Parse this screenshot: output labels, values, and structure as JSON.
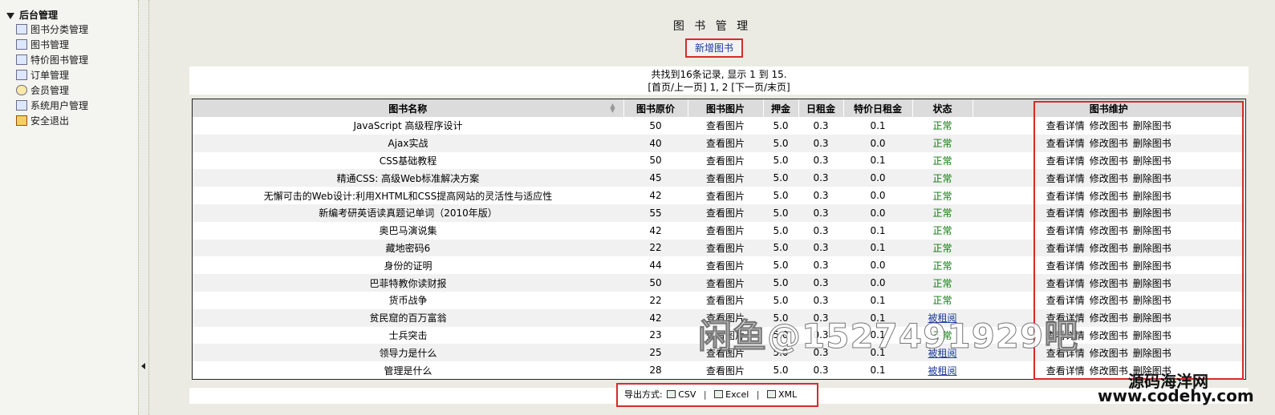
{
  "sidebar": {
    "section_title": "后台管理",
    "items": [
      {
        "label": "图书分类管理",
        "icon": "category-icon"
      },
      {
        "label": "图书管理",
        "icon": "book-icon"
      },
      {
        "label": "特价图书管理",
        "icon": "special-book-icon"
      },
      {
        "label": "订单管理",
        "icon": "order-icon"
      },
      {
        "label": "会员管理",
        "icon": "members-icon"
      },
      {
        "label": "系统用户管理",
        "icon": "user-icon"
      },
      {
        "label": "安全退出",
        "icon": "exit-icon"
      }
    ]
  },
  "main": {
    "title": "图 书 管 理",
    "add_button": "新增图书",
    "pager": {
      "summary": "共找到16条记录, 显示 1 到 15.",
      "nav_open": "[",
      "first_prev": "首页/上一页",
      "nav_close_pages": "] 1, 2 [",
      "next_last": "下一页/末页",
      "nav_end": "]"
    },
    "columns": [
      "图书名称",
      "图书原价",
      "图书图片",
      "押金",
      "日租金",
      "特价日租金",
      "状态",
      "图书维护"
    ],
    "actions": {
      "view": "查看详情",
      "edit": "修改图书",
      "delete": "删除图书"
    },
    "rows": [
      {
        "name": "JavaScript 高级程序设计",
        "price": "50",
        "image": "查看图片",
        "deposit": "5.0",
        "rent": "0.3",
        "special": "0.1",
        "status": "正常",
        "status_type": "normal"
      },
      {
        "name": "Ajax实战",
        "price": "40",
        "image": "查看图片",
        "deposit": "5.0",
        "rent": "0.3",
        "special": "0.0",
        "status": "正常",
        "status_type": "normal"
      },
      {
        "name": "CSS基础教程",
        "price": "50",
        "image": "查看图片",
        "deposit": "5.0",
        "rent": "0.3",
        "special": "0.1",
        "status": "正常",
        "status_type": "normal"
      },
      {
        "name": "精通CSS: 高级Web标准解决方案",
        "price": "45",
        "image": "查看图片",
        "deposit": "5.0",
        "rent": "0.3",
        "special": "0.0",
        "status": "正常",
        "status_type": "normal"
      },
      {
        "name": "无懈可击的Web设计:利用XHTML和CSS提高网站的灵活性与适应性",
        "price": "42",
        "image": "查看图片",
        "deposit": "5.0",
        "rent": "0.3",
        "special": "0.0",
        "status": "正常",
        "status_type": "normal"
      },
      {
        "name": "新编考研英语读真题记单词（2010年版）",
        "price": "55",
        "image": "查看图片",
        "deposit": "5.0",
        "rent": "0.3",
        "special": "0.0",
        "status": "正常",
        "status_type": "normal"
      },
      {
        "name": "奥巴马演说集",
        "price": "42",
        "image": "查看图片",
        "deposit": "5.0",
        "rent": "0.3",
        "special": "0.1",
        "status": "正常",
        "status_type": "normal"
      },
      {
        "name": "藏地密码6",
        "price": "22",
        "image": "查看图片",
        "deposit": "5.0",
        "rent": "0.3",
        "special": "0.1",
        "status": "正常",
        "status_type": "normal"
      },
      {
        "name": "身份的证明",
        "price": "44",
        "image": "查看图片",
        "deposit": "5.0",
        "rent": "0.3",
        "special": "0.0",
        "status": "正常",
        "status_type": "normal"
      },
      {
        "name": "巴菲特教你读财报",
        "price": "50",
        "image": "查看图片",
        "deposit": "5.0",
        "rent": "0.3",
        "special": "0.0",
        "status": "正常",
        "status_type": "normal"
      },
      {
        "name": "货币战争",
        "price": "22",
        "image": "查看图片",
        "deposit": "5.0",
        "rent": "0.3",
        "special": "0.1",
        "status": "正常",
        "status_type": "normal"
      },
      {
        "name": "贫民窟的百万富翁",
        "price": "42",
        "image": "查看图片",
        "deposit": "5.0",
        "rent": "0.3",
        "special": "0.1",
        "status": "被租阅",
        "status_type": "rented"
      },
      {
        "name": "士兵突击",
        "price": "23",
        "image": "查看图片",
        "deposit": "5.0",
        "rent": "0.3",
        "special": "0.1",
        "status": "正常",
        "status_type": "normal"
      },
      {
        "name": "领导力是什么",
        "price": "25",
        "image": "查看图片",
        "deposit": "5.0",
        "rent": "0.3",
        "special": "0.1",
        "status": "被租阅",
        "status_type": "rented"
      },
      {
        "name": "管理是什么",
        "price": "28",
        "image": "查看图片",
        "deposit": "5.0",
        "rent": "0.3",
        "special": "0.1",
        "status": "被租阅",
        "status_type": "rented"
      }
    ],
    "export": {
      "label": "导出方式:",
      "csv": "CSV",
      "excel": "Excel",
      "xml": "XML",
      "sep": "|"
    }
  },
  "watermark": {
    "line1": "闲鱼@1527491929吧",
    "line2": "源码海洋网",
    "line3": "www.codehy.com"
  },
  "colors": {
    "highlight_box": "#d62b2b",
    "status_normal": "#0a7a0a",
    "status_rented": "#1b3b9c"
  }
}
